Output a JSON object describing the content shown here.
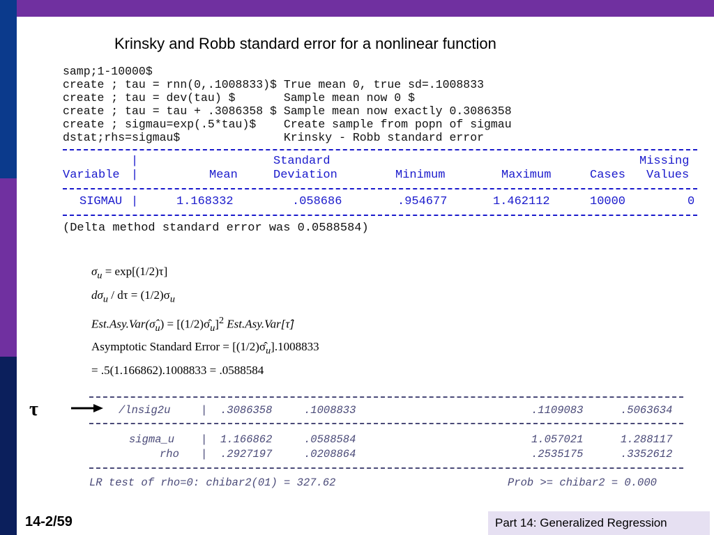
{
  "slide": {
    "title": "Krinsky and Robb standard error for a nonlinear function",
    "page_number": "14-2/59",
    "footer": "Part 14: Generalized Regression"
  },
  "commands": [
    "samp;1-10000$",
    "create ; tau = rnn(0,.1008833)$ True mean 0, true sd=.1008833",
    "create ; tau = dev(tau) $       Sample mean now 0 $",
    "create ; tau = tau + .3086358 $ Sample mean now exactly 0.3086358",
    "create ; sigmau=exp(.5*tau)$    Create sample from popn of sigmau",
    "dstat;rhs=sigmau$               Krinsky - Robb standard error"
  ],
  "dstat_table": {
    "header_top": {
      "standard": "Standard",
      "missing": "Missing"
    },
    "header": {
      "variable": "Variable",
      "mean": "Mean",
      "std_dev": "Deviation",
      "minimum": "Minimum",
      "maximum": "Maximum",
      "cases": "Cases",
      "missing": "Values"
    },
    "row": {
      "variable": "SIGMAU",
      "mean": "1.168332",
      "std_dev": ".058686",
      "minimum": ".954677",
      "maximum": "1.462112",
      "cases": "10000",
      "missing": "0"
    }
  },
  "delta_note": "(Delta method standard error was 0.0588584)",
  "equations": {
    "eq1_rhs": "= exp[(1/2)τ]",
    "eq2_mid": " / dτ = (1/2)σ",
    "eq3_lhs": "Est.Asy.Var(σ̂",
    "eq3_rhs": ") = [(1/2)σ̂",
    "eq3_tail": "Est.Asy.Var[τ̂]",
    "eq4_text": "Asymptotic Standard Error = [(1/2)σ̂",
    "eq4_tail": "].1008833",
    "eq5_text": "= .5(1.166862).1008833 = .0588584",
    "sub_u": "u",
    "sup_2": "2"
  },
  "tau_symbol": "τ",
  "output_table": {
    "rows": [
      {
        "label": "/lnsig2u",
        "coef": ".3086358",
        "se": ".1008833",
        "lo": ".1109083",
        "hi": ".5063634"
      },
      {
        "label": "sigma_u",
        "coef": "1.166862",
        "se": ".0588584",
        "lo": "1.057021",
        "hi": "1.288117"
      },
      {
        "label": "rho",
        "coef": ".2927197",
        "se": ".0208864",
        "lo": ".2535175",
        "hi": ".3352612"
      }
    ],
    "lr_test": "LR test of rho=0: chibar2(01) = 327.62",
    "prob": "Prob >= chibar2 = 0.000"
  }
}
